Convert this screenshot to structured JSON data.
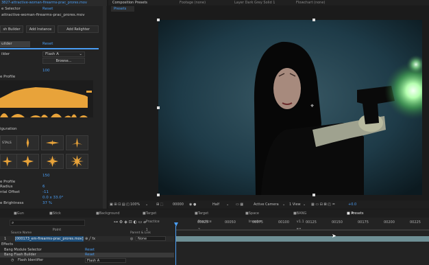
{
  "left_panel": {
    "file_name": "attractive-woman-firearms-prac_prores.mov",
    "reset_top": "Reset",
    "buttons": [
      "sh Builder",
      "Add Instance",
      "Add Relighter"
    ],
    "builder_tag": "uilder",
    "builder_reset": "Reset",
    "flash_label": "ilder",
    "flash_value": "Flash A",
    "browse_label": "Browse...",
    "size_value": "100",
    "profile_label": "e Profile",
    "config_label": "iguration",
    "stals_label": "STALS",
    "row_value_150": "150",
    "rows": [
      {
        "label": "e Profile",
        "value": ""
      },
      {
        "label": "Radius",
        "value": "6"
      },
      {
        "label": "ntal Offset",
        "value": "-11"
      },
      {
        "label": "",
        "value": "0.0 x 33.0°"
      },
      {
        "label": "e Brightness",
        "value": "37 %"
      }
    ]
  },
  "viewer": {
    "tabs": [
      "Composition Presets",
      "Footage (none)",
      "Layer Dark Grey Solid 1",
      "Flowchart (none)"
    ],
    "sub_tab": "Presets",
    "bottom_bar": {
      "zoom": "100%",
      "timecode": "00000",
      "resolution": "Half",
      "camera": "Active Camera",
      "view": "1 View",
      "exposure": "+0.0"
    }
  },
  "timeline": {
    "tabs": [
      "Gun",
      "Stick To Point",
      "Background",
      "Target Practice 1",
      "Target Practice 2",
      "Space Invader",
      "BANG v1.1 EZ Aim",
      "Presets"
    ],
    "ruler": [
      "00025",
      "00050",
      "00075",
      "00100",
      "00125",
      "00150",
      "00175",
      "00200",
      "00225"
    ],
    "header": {
      "source_name": "Source Name",
      "parent_link": "Parent & Link"
    },
    "layer": {
      "index": "1",
      "name": "[000173_em-firearms-prac_prores.mov]",
      "parent": "None"
    },
    "effects_label": "Effects",
    "props": [
      {
        "name": "Bang Module Selector",
        "value": "Reset"
      },
      {
        "name": "Bang Flash Builder",
        "value": "Reset"
      },
      {
        "name": "Flash Identifier",
        "value": "Flash A"
      }
    ]
  },
  "colors": {
    "accent": "#4a9ef5",
    "orange": "#e8a33a",
    "bg": "#1a1a1a"
  }
}
